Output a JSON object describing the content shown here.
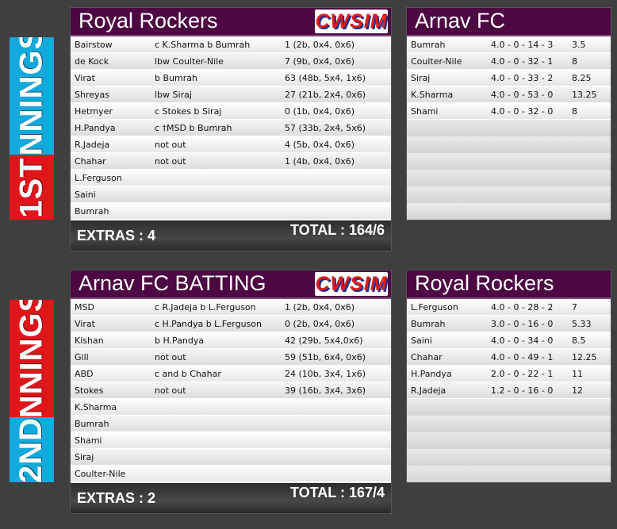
{
  "innings1": {
    "label_num": "1ST",
    "label_word": "INNINGS",
    "batting": {
      "team": "Royal Rockers",
      "logo_text": "CWSIM",
      "rows": [
        {
          "name": "Bairstow",
          "how": "c K.Sharma b Bumrah",
          "score": "1 (2b, 0x4, 0x6)"
        },
        {
          "name": "de Kock",
          "how": "lbw Coulter-Nile",
          "score": "7 (9b, 0x4, 0x6)"
        },
        {
          "name": "Virat",
          "how": "b Bumrah",
          "score": "63 (48b, 5x4, 1x6)"
        },
        {
          "name": "Shreyas",
          "how": "lbw Siraj",
          "score": "27 (21b, 2x4, 0x6)"
        },
        {
          "name": "Hetmyer",
          "how": "c Stokes b Siraj",
          "score": "0 (1b, 0x4, 0x6)"
        },
        {
          "name": "H.Pandya",
          "how": "c †MSD b Bumrah",
          "score": "57 (33b, 2x4, 5x6)"
        },
        {
          "name": "R.Jadeja",
          "how": "not out",
          "score": "4 (5b, 0x4, 0x6)"
        },
        {
          "name": "Chahar",
          "how": "not out",
          "score": "1 (4b, 0x4, 0x6)"
        },
        {
          "name": "L.Ferguson",
          "how": "",
          "score": ""
        },
        {
          "name": "Saini",
          "how": "",
          "score": ""
        },
        {
          "name": "Bumrah",
          "how": "",
          "score": ""
        }
      ],
      "extras": "EXTRAS : 4",
      "total": "TOTAL : 164/6"
    },
    "bowling": {
      "team": "Arnav FC",
      "rows": [
        {
          "name": "Bumrah",
          "figures": "4.0 - 0 - 14 - 3",
          "econ": "3.5"
        },
        {
          "name": "Coulter-Nile",
          "figures": "4.0 - 0 - 32 - 1",
          "econ": "8"
        },
        {
          "name": "Siraj",
          "figures": "4.0 - 0 - 33 - 2",
          "econ": "8.25"
        },
        {
          "name": "K.Sharma",
          "figures": "4.0 - 0 - 53 - 0",
          "econ": "13.25"
        },
        {
          "name": "Shami",
          "figures": "4.0 - 0 - 32 - 0",
          "econ": "8"
        }
      ]
    }
  },
  "innings2": {
    "label_num": "2ND",
    "label_word": "INNINGS",
    "batting": {
      "team": "Arnav FC BATTING",
      "logo_text": "CWSIM",
      "rows": [
        {
          "name": "MSD",
          "how": "c R.Jadeja b L.Ferguson",
          "score": "1 (2b, 0x4, 0x6)"
        },
        {
          "name": "Virat",
          "how": "c H.Pandya b L.Ferguson",
          "score": "0 (2b, 0x4, 0x6)"
        },
        {
          "name": "Kishan",
          "how": "b H.Pandya",
          "score": "42 (29b, 5x4,0x6)"
        },
        {
          "name": "Gill",
          "how": "not out",
          "score": "59 (51b, 6x4, 0x6)"
        },
        {
          "name": "ABD",
          "how": "c and b Chahar",
          "score": "24 (10b, 3x4, 1x6)"
        },
        {
          "name": "Stokes",
          "how": "not out",
          "score": "39 (16b, 3x4, 3x6)"
        },
        {
          "name": "K.Sharma",
          "how": "",
          "score": ""
        },
        {
          "name": "Bumrah",
          "how": "",
          "score": ""
        },
        {
          "name": "Shami",
          "how": "",
          "score": ""
        },
        {
          "name": "Siraj",
          "how": "",
          "score": ""
        },
        {
          "name": "Coulter-Nile",
          "how": "",
          "score": ""
        }
      ],
      "extras": "EXTRAS : 2",
      "total": "TOTAL : 167/4"
    },
    "bowling": {
      "team": "Royal Rockers",
      "rows": [
        {
          "name": "L.Ferguson",
          "figures": "4.0 - 0 - 28 - 2",
          "econ": "7"
        },
        {
          "name": "Bumrah",
          "figures": "3.0 - 0 - 16 - 0",
          "econ": "5.33"
        },
        {
          "name": "Saini",
          "figures": "4.0 - 0 - 34 - 0",
          "econ": "8.5"
        },
        {
          "name": "Chahar",
          "figures": "4.0 - 0 - 49 - 1",
          "econ": "12.25"
        },
        {
          "name": "H.Pandya",
          "figures": "2.0 - 0 - 22 - 1",
          "econ": "11"
        },
        {
          "name": "R.Jadeja",
          "figures": "1.2 - 0 - 16 - 0",
          "econ": "12"
        }
      ]
    }
  },
  "colors": {
    "header_bg": "#4d0743",
    "label_blue": "#12aadc",
    "label_red": "#e0161a",
    "background": "#3f3f3f"
  }
}
